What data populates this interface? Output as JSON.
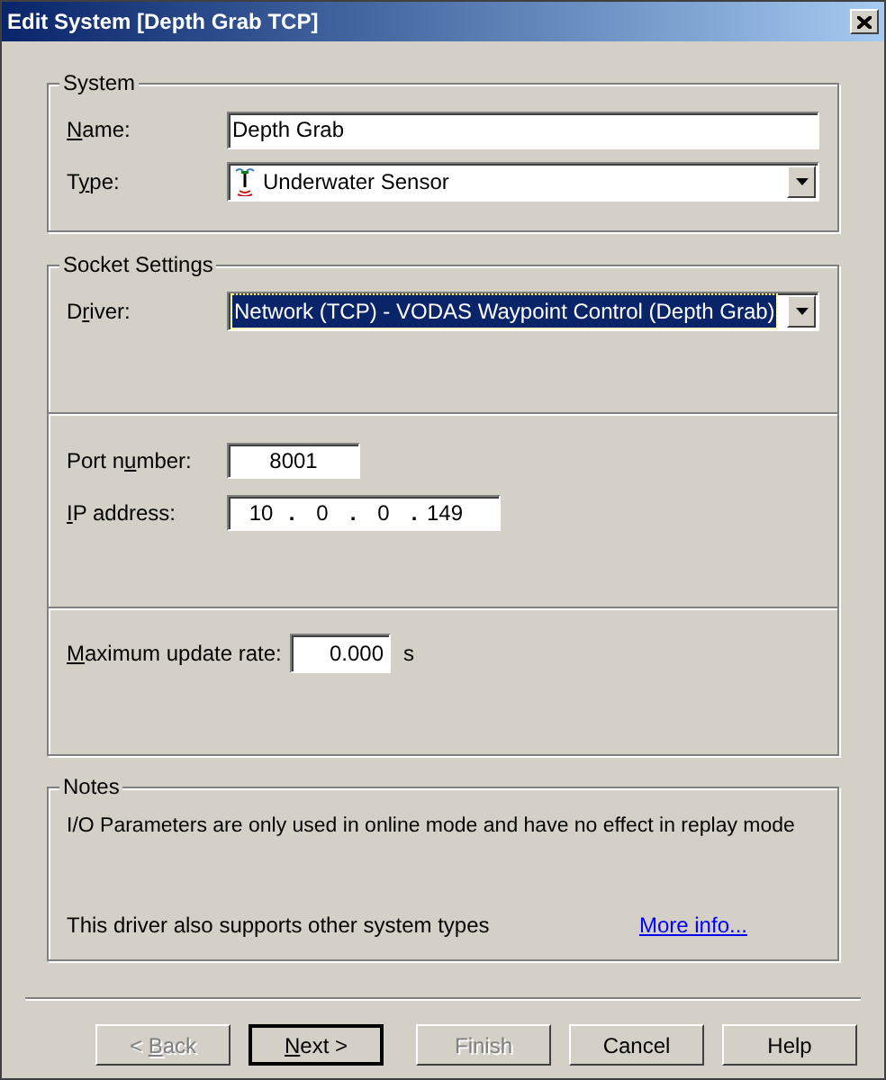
{
  "window": {
    "title": "Edit System [Depth Grab TCP]"
  },
  "system": {
    "title": "System",
    "name": {
      "label": {
        "key": "N",
        "rest": "ame:"
      },
      "value": "Depth Grab"
    },
    "type": {
      "label": {
        "lead": "T",
        "key": "y",
        "rest": "pe:"
      },
      "value": "Underwater Sensor"
    }
  },
  "socket_settings": {
    "title": "Socket Settings",
    "driver": {
      "label": {
        "lead": "D",
        "key": "r",
        "rest": "iver:"
      },
      "value": "Network (TCP) - VODAS Waypoint Control (Depth Grab)",
      "selected": true
    },
    "port": {
      "label": {
        "lead": "Port n",
        "key": "u",
        "rest": "mber:"
      },
      "value": "8001"
    },
    "ip": {
      "label": {
        "key": "I",
        "rest": "P address:"
      },
      "octets": [
        "10",
        "0",
        "0",
        "149"
      ],
      "dot": "."
    },
    "rate": {
      "label": {
        "key": "M",
        "rest": "aximum update rate:"
      },
      "value": "0.000",
      "unit": "s"
    }
  },
  "notes": {
    "title": "Notes",
    "text": "I/O Parameters are only used in online mode and have no effect in replay mode",
    "footer": "This driver also supports other system types",
    "link": "More info..."
  },
  "buttons": [
    {
      "label": {
        "lead": "< ",
        "key": "B",
        "rest": "ack"
      },
      "disabled": true,
      "default": false
    },
    {
      "label": {
        "key": "N",
        "rest": "ext >"
      },
      "disabled": false,
      "default": true
    },
    {
      "label": {
        "rest": "Finish"
      },
      "disabled": true,
      "default": false
    },
    {
      "label": {
        "rest": "Cancel"
      },
      "disabled": false,
      "default": false
    },
    {
      "label": {
        "rest": "Help"
      },
      "disabled": false,
      "default": false
    }
  ]
}
